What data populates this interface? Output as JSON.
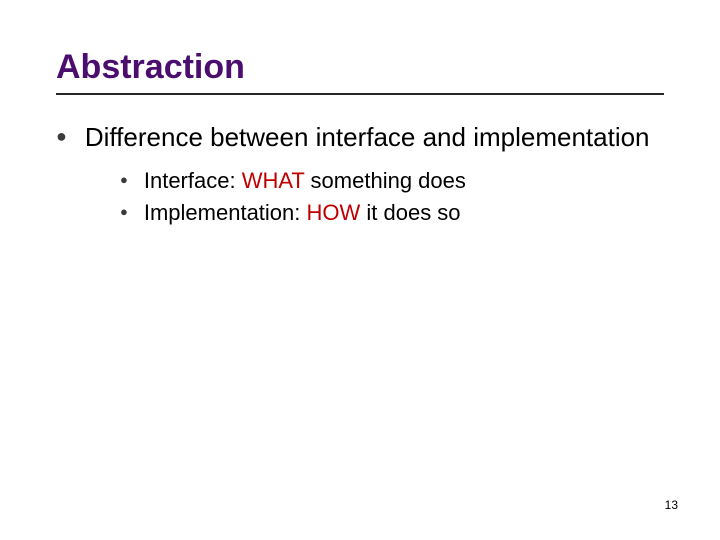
{
  "title": "Abstraction",
  "lvl1_text": "Difference between interface and implementation",
  "sub1_pre": "Interface: ",
  "sub1_kw": "WHAT",
  "sub1_post": " something does",
  "sub2_pre": "Implementation: ",
  "sub2_kw": "HOW",
  "sub2_post": " it does so",
  "page_number": "13"
}
